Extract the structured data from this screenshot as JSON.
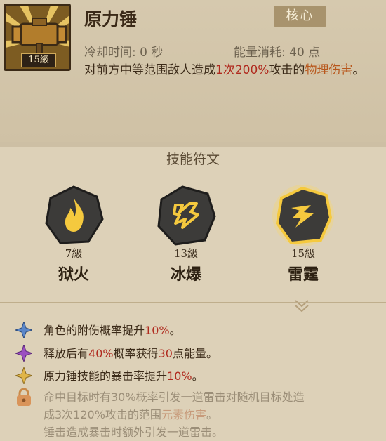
{
  "skill": {
    "level": "15級",
    "name": "原力锤",
    "badge": "核心",
    "cooldown": "冷却时间: 0 秒",
    "energy": "能量消耗: 40 点",
    "desc_part1": "对前方中等范围敌人造成",
    "desc_count": "1次",
    "desc_pct": "200%",
    "desc_part2": "攻击的",
    "desc_dmg": "物理伤害",
    "desc_end": "。"
  },
  "runes_panel": {
    "title": "技能符文",
    "runes": [
      {
        "level": "7級",
        "name": "狱火",
        "icon": "flame-rune-icon"
      },
      {
        "level": "13級",
        "name": "冰爆",
        "icon": "ice-burst-rune-icon"
      },
      {
        "level": "15級",
        "name": "雷霆",
        "icon": "thunder-rune-icon"
      }
    ]
  },
  "effects": [
    {
      "icon": "blue-star-icon",
      "pre": "角色的附伤概率提升",
      "hl": "10%",
      "post": "。"
    },
    {
      "icon": "purple-star-icon",
      "pre": "释放后有",
      "hl": "40%",
      "mid": "概率获得",
      "hl2": "30",
      "post": "点能量。"
    },
    {
      "icon": "gold-star-icon",
      "pre": "原力锤技能的暴击率提升",
      "hl": "10%",
      "post": "。"
    }
  ],
  "locked_effect": {
    "icon": "lock-icon",
    "line1": "命中目标时有30%概率引发一道雷击对随机目标处造",
    "line2a": "成3次120%攻击的范围",
    "line2b": "元素伤害",
    "line2c": "。",
    "line3": "锤击造成暴击时额外引发一道雷击。"
  },
  "colors": {
    "highlight": "#b02a1e",
    "damage": "#b8571c",
    "locked": "#9b8e78"
  }
}
